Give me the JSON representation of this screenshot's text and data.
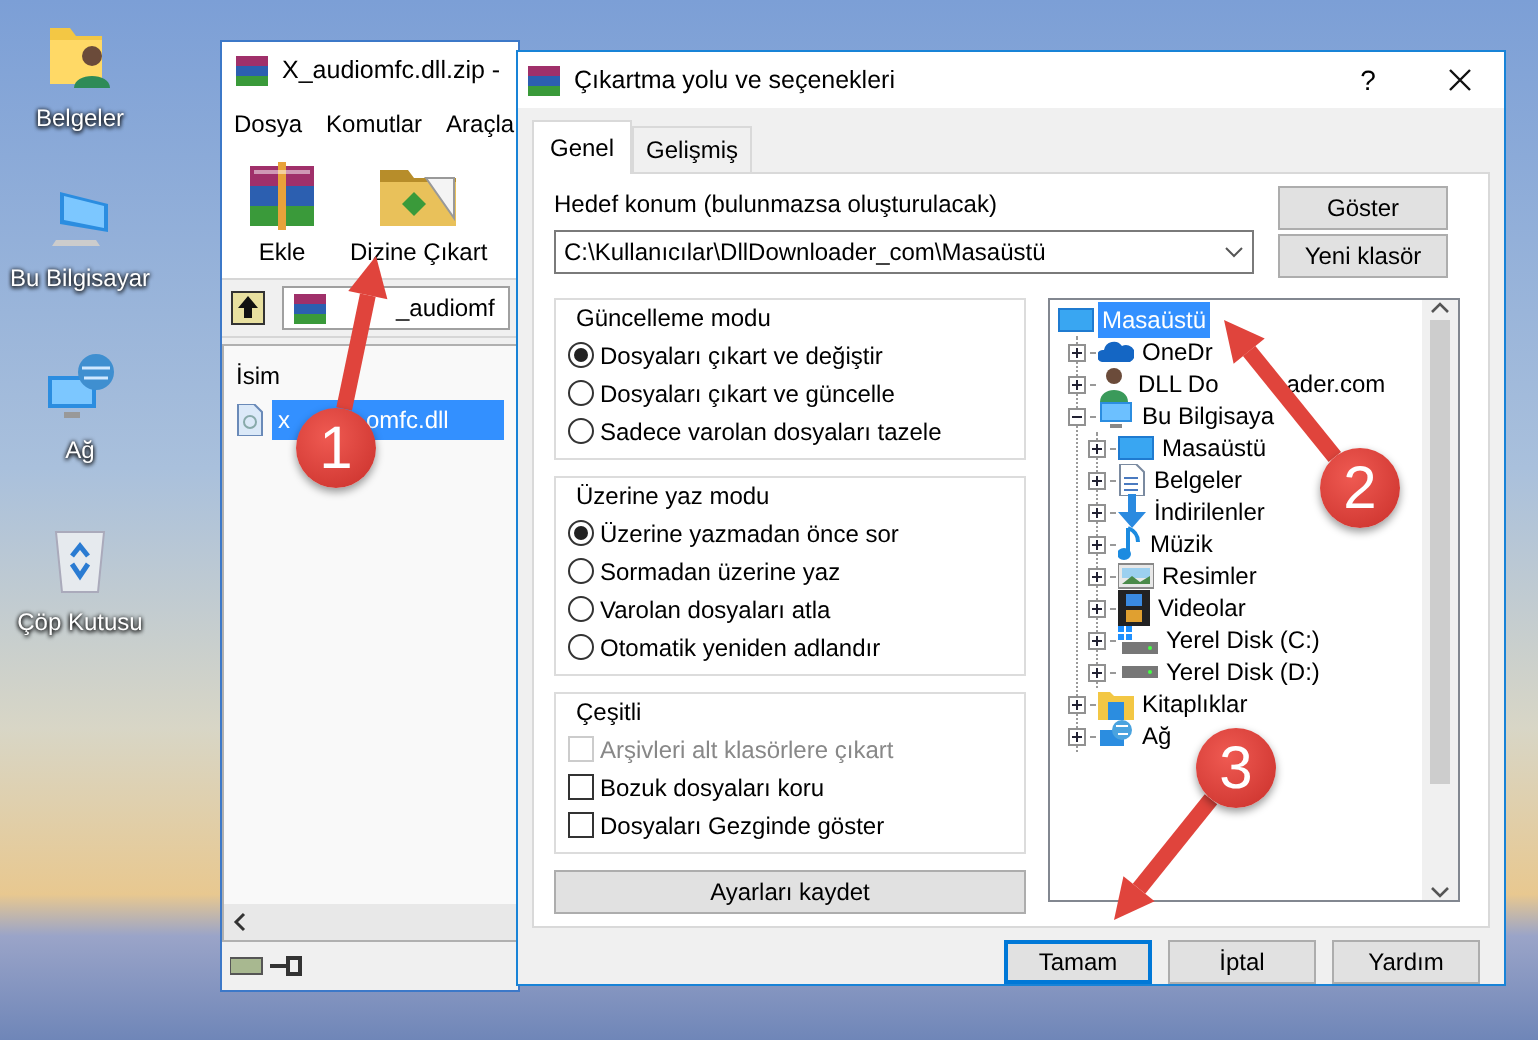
{
  "desktop_icons": [
    {
      "label": "Belgeler",
      "kind": "user-folder"
    },
    {
      "label": "Bu Bilgisayar",
      "kind": "computer"
    },
    {
      "label": "Ağ",
      "kind": "network"
    },
    {
      "label": "Çöp Kutusu",
      "kind": "recycle"
    }
  ],
  "archiver": {
    "title": "X_audiomfc.dll.zip -",
    "menu": [
      "Dosya",
      "Komutlar",
      "Araçla"
    ],
    "toolbar": [
      {
        "label": "Ekle",
        "kind": "archive"
      },
      {
        "label": "Dizine Çıkart",
        "kind": "extract"
      }
    ],
    "path": "_audiomf",
    "column": "İsim",
    "files": [
      {
        "name": "x",
        "name_tail": "omfc.dll",
        "selected": true
      }
    ]
  },
  "dialog": {
    "title": "Çıkartma yolu ve seçenekleri",
    "help": "?",
    "tabs": [
      {
        "label": "Genel",
        "selected": true
      },
      {
        "label": "Gelişmiş",
        "selected": false
      }
    ],
    "destination_label": "Hedef konum (bulunmazsa oluşturulacak)",
    "destination": "C:\\Kullanıcılar\\DllDownloader_com\\Masaüstü",
    "side_buttons": [
      "Göster",
      "Yeni klasör"
    ],
    "groups": [
      {
        "title": "Güncelleme modu",
        "kind": "radio",
        "options": [
          {
            "label": "Dosyaları çıkart ve değiştir",
            "selected": true
          },
          {
            "label": "Dosyaları çıkart ve güncelle",
            "selected": false
          },
          {
            "label": "Sadece varolan dosyaları tazele",
            "selected": false
          }
        ]
      },
      {
        "title": "Üzerine yaz modu",
        "kind": "radio",
        "options": [
          {
            "label": "Üzerine yazmadan önce sor",
            "selected": true
          },
          {
            "label": "Sormadan üzerine yaz",
            "selected": false
          },
          {
            "label": "Varolan dosyaları atla",
            "selected": false
          },
          {
            "label": "Otomatik yeniden adlandır",
            "selected": false
          }
        ]
      },
      {
        "title": "Çeşitli",
        "kind": "checkbox",
        "options": [
          {
            "label": "Arşivleri alt klasörlere çıkart",
            "checked": false,
            "disabled": true
          },
          {
            "label": "Bozuk dosyaları koru",
            "checked": false,
            "disabled": false
          },
          {
            "label": "Dosyaları Gezginde göster",
            "checked": false,
            "disabled": false
          }
        ]
      }
    ],
    "save_button": "Ayarları kaydet",
    "tree": [
      {
        "label": "Masaüstü",
        "kind": "desktop",
        "selected": true,
        "children": [
          {
            "label": "OneDr",
            "kind": "cloud",
            "selected": false,
            "expanded": false
          },
          {
            "label": "DLL Do",
            "label_tail": "ader.com",
            "kind": "person",
            "selected": false,
            "expanded": false
          },
          {
            "label": "Bu Bilgisaya",
            "kind": "computer",
            "selected": false,
            "expanded": true,
            "children": [
              {
                "label": "Masaüstü",
                "kind": "desktop",
                "selected": false,
                "expanded": false
              },
              {
                "label": "Belgeler",
                "kind": "document",
                "selected": false,
                "expanded": false
              },
              {
                "label": "İndirilenler",
                "kind": "download",
                "selected": false,
                "expanded": false
              },
              {
                "label": "Müzik",
                "kind": "music",
                "selected": false,
                "expanded": false
              },
              {
                "label": "Resimler",
                "kind": "image",
                "selected": false,
                "expanded": false
              },
              {
                "label": "Videolar",
                "kind": "film",
                "selected": false,
                "expanded": false
              },
              {
                "label": "Yerel Disk (C:)",
                "kind": "system-drive",
                "selected": false,
                "expanded": false
              },
              {
                "label": "Yerel Disk (D:)",
                "kind": "drive",
                "selected": false,
                "expanded": false
              }
            ]
          },
          {
            "label": "Kitaplıklar",
            "kind": "library",
            "selected": false,
            "expanded": false
          },
          {
            "label": "Ağ",
            "kind": "network",
            "selected": false,
            "expanded": false
          }
        ]
      }
    ],
    "buttons": [
      {
        "label": "Tamam",
        "focused": true
      },
      {
        "label": "İptal",
        "focused": false
      },
      {
        "label": "Yardım",
        "focused": false
      }
    ]
  },
  "callouts": [
    {
      "number": "1"
    },
    {
      "number": "2"
    },
    {
      "number": "3"
    }
  ]
}
